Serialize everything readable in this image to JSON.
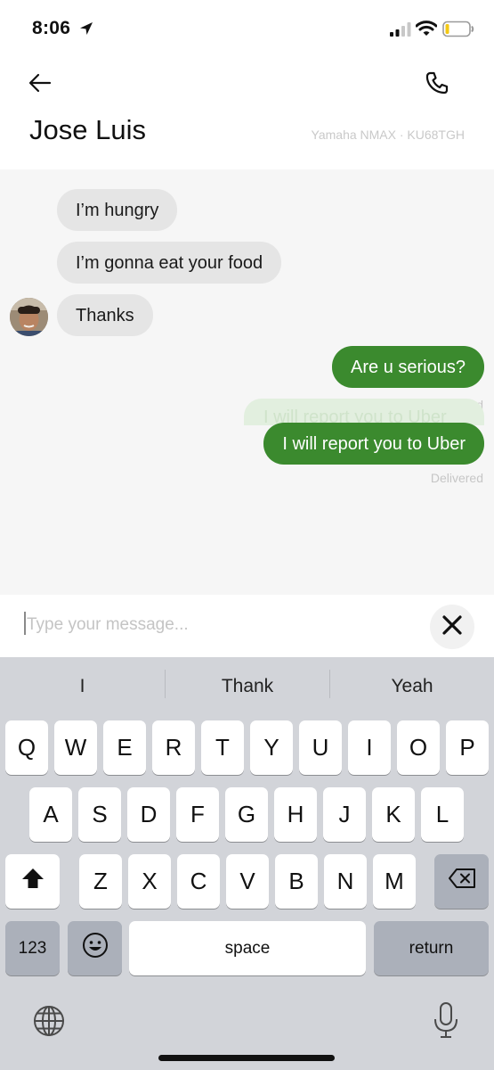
{
  "status_bar": {
    "time": "8:06"
  },
  "header": {
    "contact_name": "Jose Luis",
    "vehicle": "Yamaha NMAX · KU68TGH"
  },
  "messages": {
    "incoming": [
      "I’m hungry",
      "I’m gonna eat your food",
      "Thanks"
    ],
    "outgoing": [
      "Are u serious?",
      "I will report you to Uber"
    ],
    "receipt_read": "Read",
    "receipt_delivered": "Delivered"
  },
  "composer": {
    "placeholder": "Type your message..."
  },
  "keyboard": {
    "suggestions": [
      "I",
      "Thank",
      "Yeah"
    ],
    "row1": [
      "Q",
      "W",
      "E",
      "R",
      "T",
      "Y",
      "U",
      "I",
      "O",
      "P"
    ],
    "row2": [
      "A",
      "S",
      "D",
      "F",
      "G",
      "H",
      "J",
      "K",
      "L"
    ],
    "row3": [
      "Z",
      "X",
      "C",
      "V",
      "B",
      "N",
      "M"
    ],
    "numbers_label": "123",
    "space_label": "space",
    "return_label": "return"
  },
  "colors": {
    "outgoing_bubble": "#3b8a2e",
    "incoming_bubble": "#e5e5e5",
    "chat_background": "#f6f6f6",
    "keyboard_background": "#d2d4d9"
  },
  "icons": [
    "location-arrow-icon",
    "signal-icon",
    "wifi-icon",
    "battery-icon",
    "back-arrow-icon",
    "phone-icon",
    "close-icon",
    "shift-icon",
    "backspace-icon",
    "emoji-icon",
    "globe-icon",
    "microphone-icon"
  ]
}
